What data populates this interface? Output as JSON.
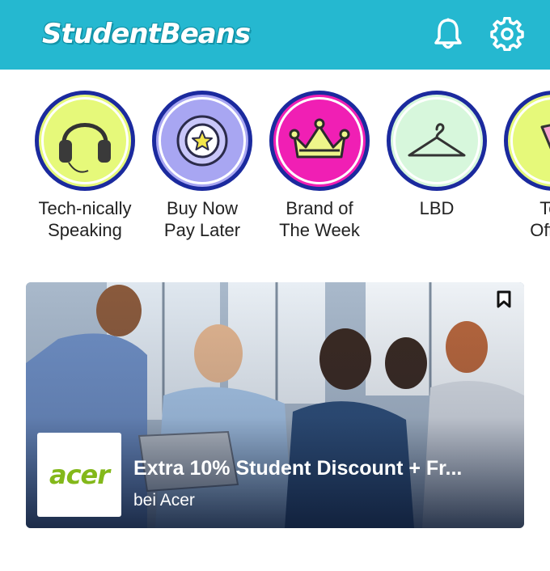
{
  "header": {
    "logo_text": "StudentBeans",
    "icons": [
      "bell-icon",
      "gear-icon"
    ],
    "background": "#25b8d0"
  },
  "categories": [
    {
      "label": "Tech-nically\nSpeaking",
      "icon": "headphones-icon",
      "color": "#e6f97a"
    },
    {
      "label": "Buy Now\nPay Later",
      "icon": "star-coin-icon",
      "color": "#a8a6f2"
    },
    {
      "label": "Brand of\nThe Week",
      "icon": "crown-icon",
      "color": "#f01fb4"
    },
    {
      "label": "LBD",
      "icon": "hanger-icon",
      "color": "#d7f7dc"
    },
    {
      "label": "Top\nOffers",
      "icon": "tag-icon",
      "color": "#e6f97a"
    }
  ],
  "offer_card": {
    "brand": "acer",
    "title": "Extra 10% Student Discount + Fr...",
    "subtitle": "bei Acer",
    "brand_color": "#83b81a"
  }
}
